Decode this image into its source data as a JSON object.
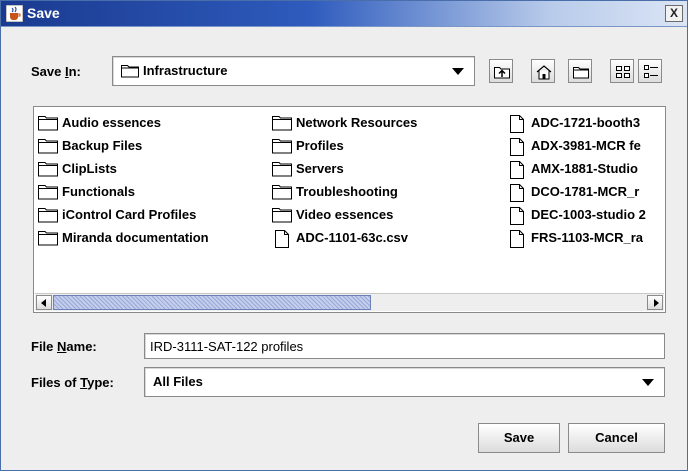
{
  "window": {
    "title": "Save",
    "close_label": "X"
  },
  "save_in": {
    "label_prefix": "Save ",
    "label_mnemonic": "I",
    "label_suffix": "n:",
    "current_folder": "Infrastructure"
  },
  "toolbar": {
    "buttons": [
      {
        "name": "up-one-level",
        "icon": "folder-up-icon"
      },
      {
        "name": "home",
        "icon": "home-icon"
      },
      {
        "name": "new-folder",
        "icon": "new-folder-icon"
      },
      {
        "name": "list-view",
        "icon": "list-view-icon"
      },
      {
        "name": "details-view",
        "icon": "details-view-icon"
      }
    ]
  },
  "files": {
    "column1": [
      {
        "type": "folder",
        "name": "Audio essences"
      },
      {
        "type": "folder",
        "name": "Backup Files"
      },
      {
        "type": "folder",
        "name": "ClipLists"
      },
      {
        "type": "folder",
        "name": "Functionals"
      },
      {
        "type": "folder",
        "name": "iControl Card Profiles"
      },
      {
        "type": "folder",
        "name": "Miranda documentation"
      }
    ],
    "column2": [
      {
        "type": "folder",
        "name": "Network Resources"
      },
      {
        "type": "folder",
        "name": "Profiles"
      },
      {
        "type": "folder",
        "name": "Servers"
      },
      {
        "type": "folder",
        "name": "Troubleshooting"
      },
      {
        "type": "folder",
        "name": "Video essences"
      },
      {
        "type": "file",
        "name": "ADC-1101-63c.csv"
      }
    ],
    "column3": [
      {
        "type": "file",
        "name": "ADC-1721-booth3"
      },
      {
        "type": "file",
        "name": "ADX-3981-MCR fe"
      },
      {
        "type": "file",
        "name": "AMX-1881-Studio"
      },
      {
        "type": "file",
        "name": "DCO-1781-MCR_r"
      },
      {
        "type": "file",
        "name": "DEC-1003-studio 2"
      },
      {
        "type": "file",
        "name": "FRS-1103-MCR_ra"
      }
    ]
  },
  "file_name": {
    "label_prefix": "File ",
    "label_mnemonic": "N",
    "label_suffix": "ame:",
    "value": "IRD-3111-SAT-122 profiles"
  },
  "file_type": {
    "label_prefix": "Files of ",
    "label_mnemonic": "T",
    "label_suffix": "ype:",
    "selected": "All Files"
  },
  "buttons": {
    "save": "Save",
    "cancel": "Cancel"
  }
}
